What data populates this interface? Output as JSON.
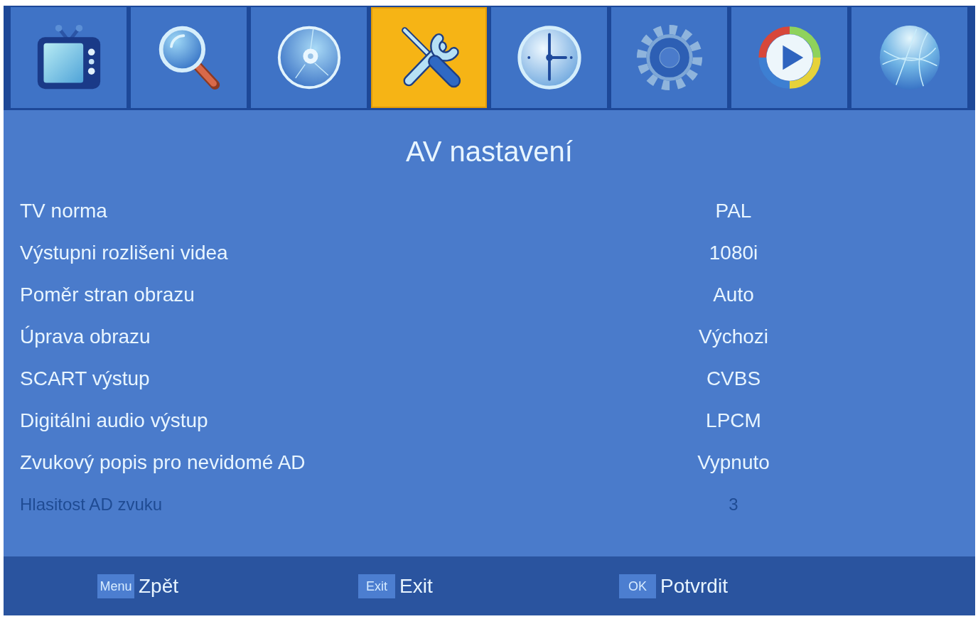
{
  "tabs": [
    {
      "kind": "tv",
      "selected": false
    },
    {
      "kind": "search",
      "selected": false
    },
    {
      "kind": "disc",
      "selected": false
    },
    {
      "kind": "tools",
      "selected": true
    },
    {
      "kind": "clock",
      "selected": false
    },
    {
      "kind": "gear",
      "selected": false
    },
    {
      "kind": "play",
      "selected": false
    },
    {
      "kind": "globe",
      "selected": false
    }
  ],
  "title": "AV nastavení",
  "settings": [
    {
      "label": "TV norma",
      "value": "PAL",
      "disabled": false
    },
    {
      "label": "Výstupni rozlišeni videa",
      "value": "1080i",
      "disabled": false
    },
    {
      "label": "Poměr stran obrazu",
      "value": "Auto",
      "disabled": false
    },
    {
      "label": "Úprava obrazu",
      "value": "Výchozi",
      "disabled": false
    },
    {
      "label": "SCART výstup",
      "value": "CVBS",
      "disabled": false
    },
    {
      "label": "Digitálni audio výstup",
      "value": "LPCM",
      "disabled": false
    },
    {
      "label": "Zvukový popis pro nevidomé AD",
      "value": "Vypnuto",
      "disabled": false
    },
    {
      "label": "Hlasitost AD zvuku",
      "value": "3",
      "disabled": true
    }
  ],
  "footer": {
    "hints": [
      {
        "key": "Menu",
        "action": "Zpět"
      },
      {
        "key": "Exit",
        "action": "Exit"
      },
      {
        "key": "OK",
        "action": "Potvrdit"
      }
    ]
  }
}
